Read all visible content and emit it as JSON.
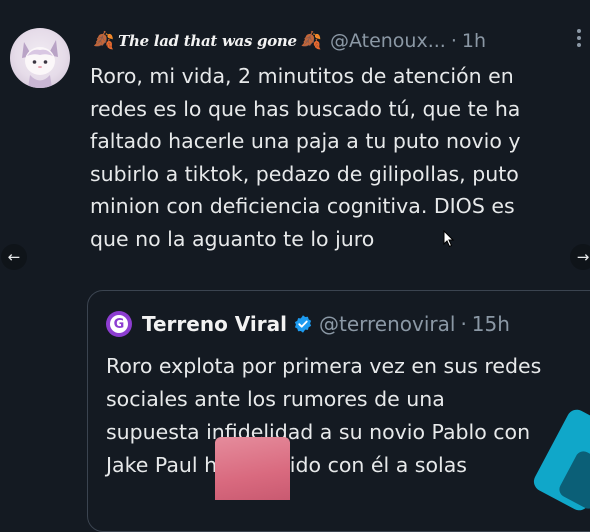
{
  "tweet": {
    "leaf_left": "🍂",
    "display_name": "The lad that was gone",
    "leaf_right": "🍂",
    "handle": "@Atenoux...",
    "separator": "·",
    "time": "1h",
    "more": "···",
    "text_lines": [
      "Roro, mi vida, 2 minutitos de atención en",
      "redes es lo que has buscado tú, que te ha",
      "faltado hacerle una paja a tu puto novio y",
      "subirlo a tiktok, pedazo de gilipollas, puto",
      "minion con deficiencia cognitiva. DIOS es",
      "que no la aguanto te lo juro"
    ]
  },
  "navigation": {
    "prev_arrow": "←",
    "next_arrow": "→"
  },
  "quote": {
    "avatar_letter": "G",
    "name": "Terreno Viral",
    "handle": "@terrenoviral",
    "separator": "·",
    "time": "15h",
    "text_lines": [
      "Roro explota por primera vez en sus redes",
      "sociales ante los rumores de una",
      "supuesta infidelidad a su novio Pablo con",
      "Jake Paul     he dormido con él a solas"
    ]
  },
  "colors": {
    "background": "#141a22",
    "text": "#e7e9ea",
    "secondary_text": "#8b98a5",
    "verified": "#1d9bf0",
    "quote_avatar": "#8d3dd1"
  }
}
